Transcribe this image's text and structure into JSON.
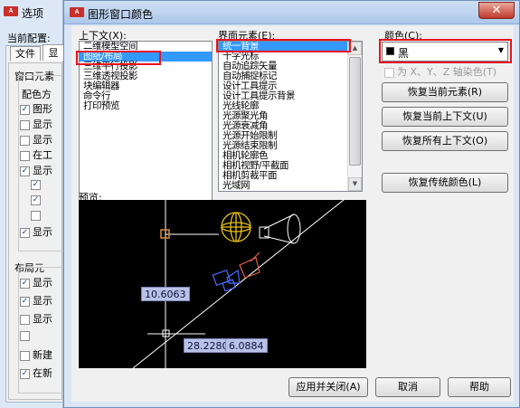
{
  "bg_window": {
    "title": "选项",
    "current_profile_label": "当前配置:",
    "tabs": [
      "文件",
      "显"
    ],
    "group1_title": "窗口元素",
    "group1_sub": "配色方",
    "group1_rows": [
      "图形",
      "显示",
      "显示",
      "在工",
      "显示",
      "",
      "",
      "",
      "显示"
    ],
    "group1_checked": [
      true,
      false,
      false,
      false,
      true,
      true,
      true,
      false,
      true
    ],
    "group2_title": "布局元",
    "group2_rows": [
      "显示",
      "显示",
      "显示",
      "",
      "新建",
      "在新"
    ],
    "group2_checked": [
      true,
      true,
      false,
      false,
      false,
      true
    ]
  },
  "dialog": {
    "title": "图形窗口颜色",
    "context_label": "上下文(X):",
    "context_items": [
      "二维模型空间",
      "图纸/布局",
      "三维平行投影",
      "三维透视投影",
      "块编辑器",
      "命令行",
      "打印预览"
    ],
    "context_selected": 1,
    "element_label": "界面元素(E):",
    "element_items": [
      "统一背景",
      "十字光标",
      "自动追踪矢量",
      "自动捕捉标记",
      "设计工具提示",
      "设计工具提示背景",
      "光线轮廓",
      "光源聚光角",
      "光源衰减角",
      "光源开始限制",
      "光源结束限制",
      "相机轮廓色",
      "相机视野/平截面",
      "相机剪裁平面",
      "光域网"
    ],
    "element_selected": 0,
    "color_label": "颜色(C):",
    "color_value": "黑",
    "color_swatch": "#000000",
    "tint_label": "为 X、Y、Z 轴染色(T)",
    "restore_element": "恢复当前元素(R)",
    "restore_context": "恢复当前上下文(U)",
    "restore_all": "恢复所有上下文(O)",
    "restore_classic": "恢复传统颜色(L)",
    "preview_label": "预览:",
    "preview": {
      "coord_a": "10.6063",
      "coord_b": "28.2280",
      "coord_c": "6.0884"
    },
    "apply_close": "应用并关闭(A)",
    "cancel": "取消",
    "help": "帮助"
  },
  "colors": {
    "selection": "#3399ff",
    "highlight_box": "#e8141b",
    "preview_bg": "#000000"
  }
}
